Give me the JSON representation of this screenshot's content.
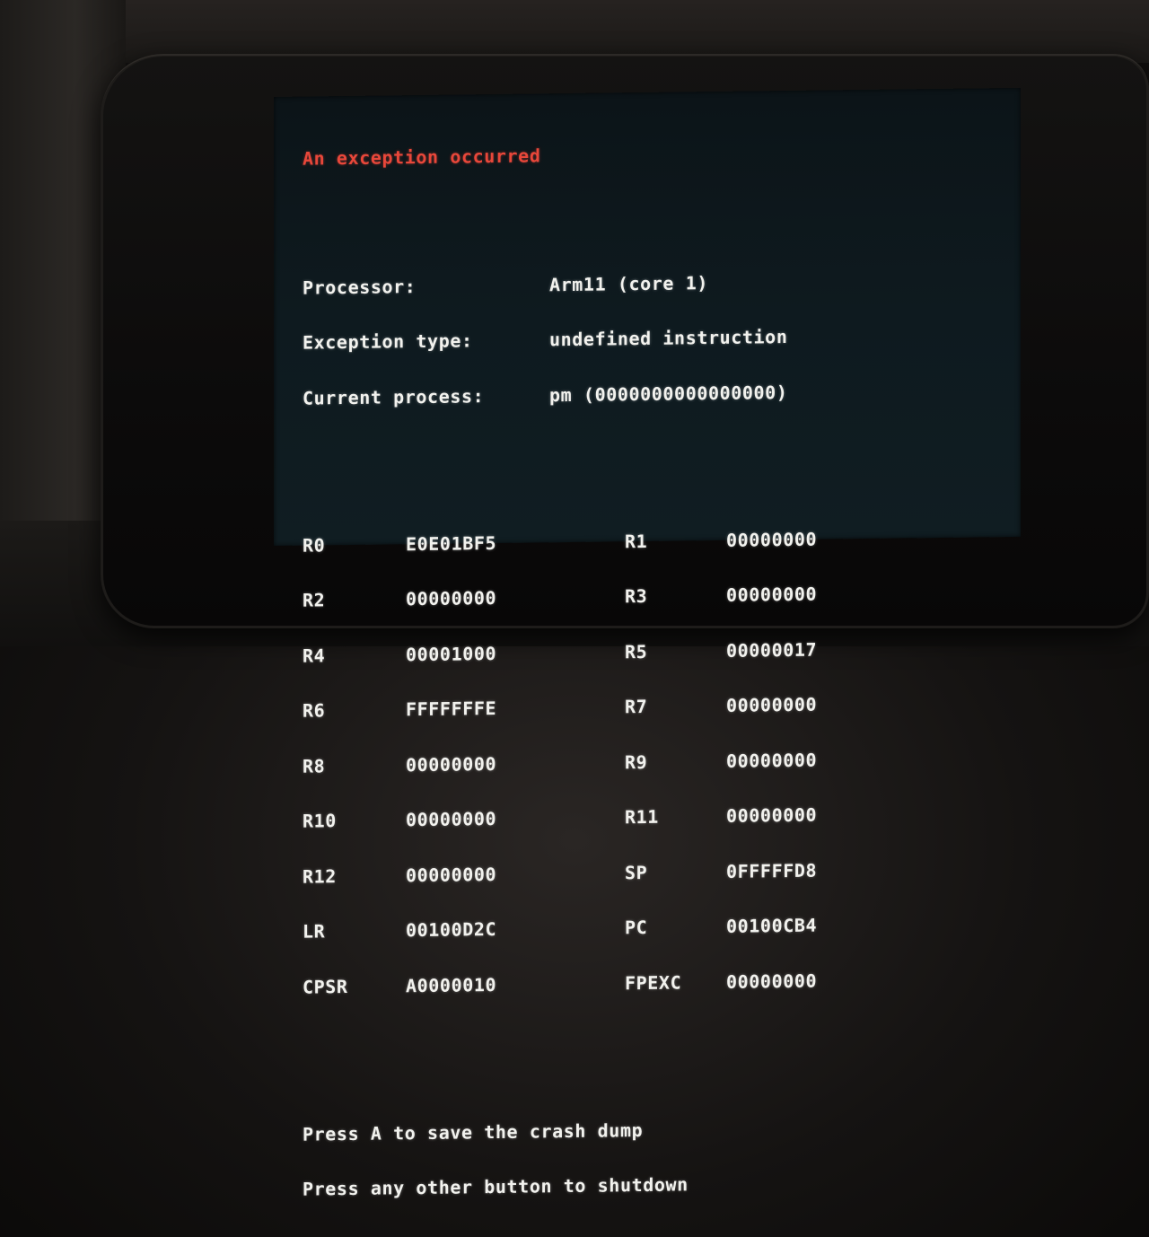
{
  "title": "An exception occurred",
  "info": [
    {
      "label": "Processor:",
      "value": "Arm11 (core 1)"
    },
    {
      "label": "Exception type:",
      "value": "undefined instruction"
    },
    {
      "label": "Current process:",
      "value": "pm (0000000000000000)"
    }
  ],
  "registers": [
    {
      "left_name": "R0",
      "left_value": "E0E01BF5",
      "right_name": "R1",
      "right_value": "00000000"
    },
    {
      "left_name": "R2",
      "left_value": "00000000",
      "right_name": "R3",
      "right_value": "00000000"
    },
    {
      "left_name": "R4",
      "left_value": "00001000",
      "right_name": "R5",
      "right_value": "00000017"
    },
    {
      "left_name": "R6",
      "left_value": "FFFFFFFE",
      "right_name": "R7",
      "right_value": "00000000"
    },
    {
      "left_name": "R8",
      "left_value": "00000000",
      "right_name": "R9",
      "right_value": "00000000"
    },
    {
      "left_name": "R10",
      "left_value": "00000000",
      "right_name": "R11",
      "right_value": "00000000"
    },
    {
      "left_name": "R12",
      "left_value": "00000000",
      "right_name": "SP",
      "right_value": "0FFFFFD8"
    },
    {
      "left_name": "LR",
      "left_value": "00100D2C",
      "right_name": "PC",
      "right_value": "00100CB4"
    },
    {
      "left_name": "CPSR",
      "left_value": "A0000010",
      "right_name": "FPEXC",
      "right_value": "00000000"
    }
  ],
  "prompts": [
    "Press A to save the crash dump",
    "Press any other button to shutdown"
  ],
  "colors": {
    "title": "#e8473a",
    "text": "#f2f2ee",
    "screen": "#0e1a1f"
  }
}
